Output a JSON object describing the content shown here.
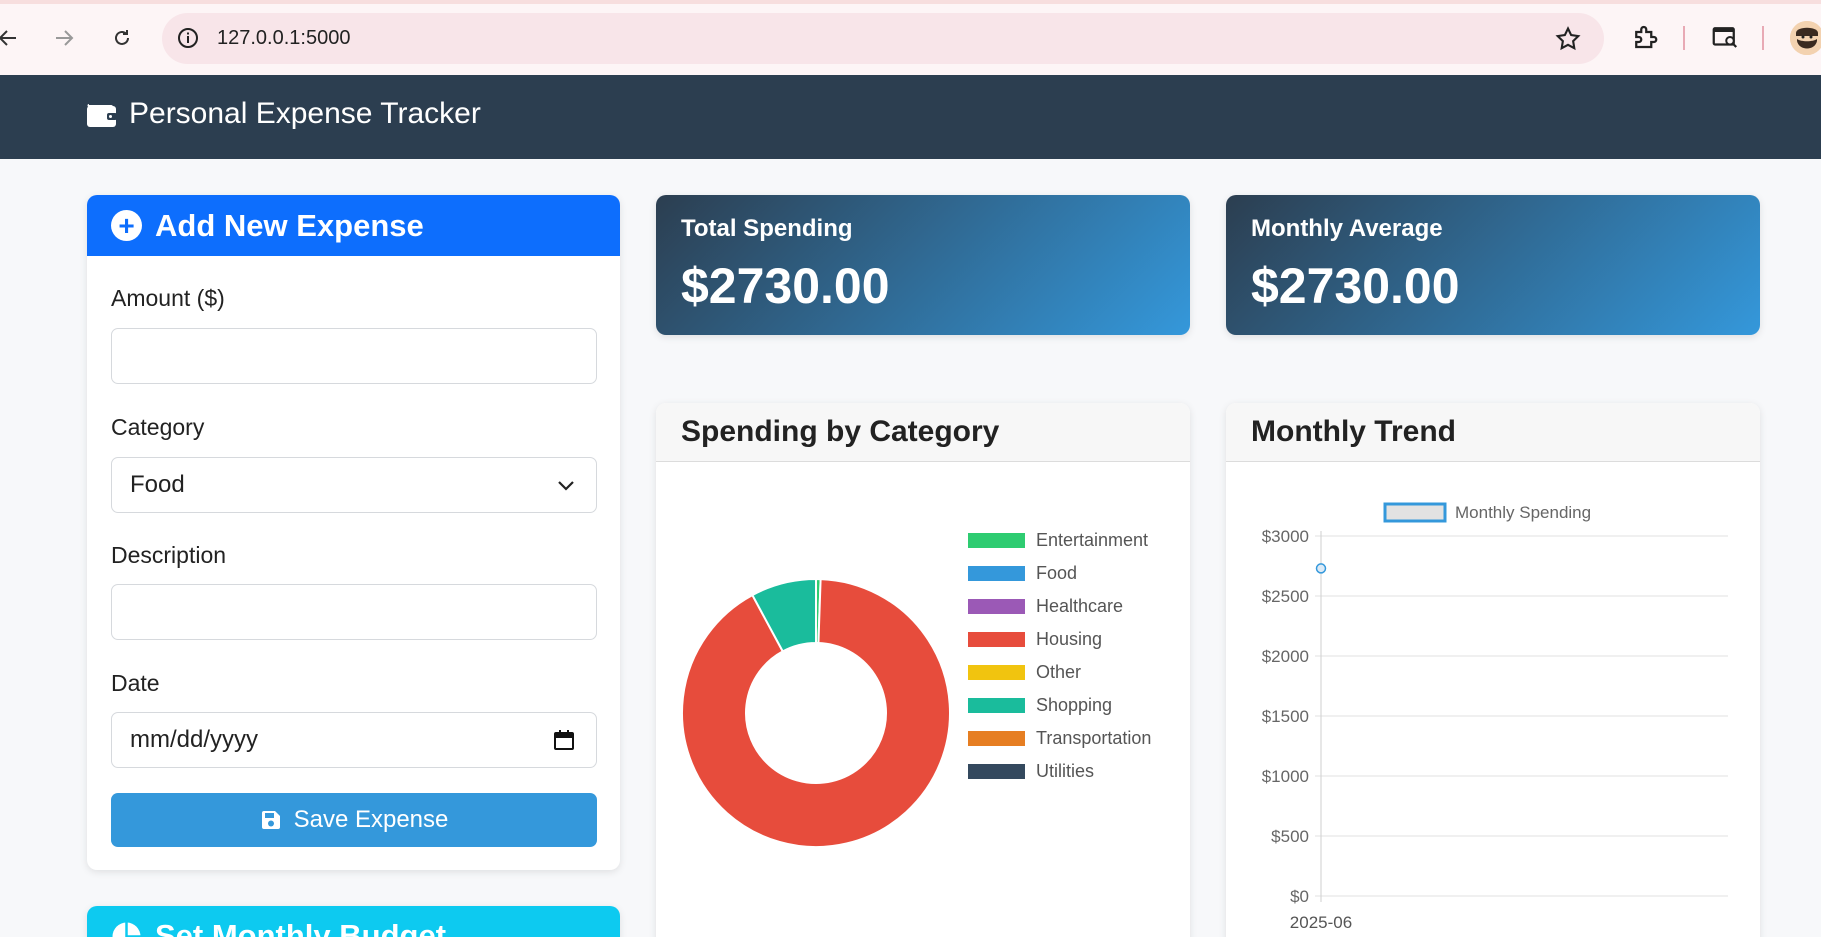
{
  "browser": {
    "url": "127.0.0.1:5000"
  },
  "app": {
    "title": "Personal Expense Tracker"
  },
  "add_expense": {
    "title": "Add New Expense",
    "amount_label": "Amount ($)",
    "amount_value": "",
    "category_label": "Category",
    "category_value": "Food",
    "description_label": "Description",
    "description_value": "",
    "date_label": "Date",
    "date_placeholder": "mm/dd/yyyy",
    "save_label": "Save Expense"
  },
  "budget": {
    "title": "Set Monthly Budget"
  },
  "stats": {
    "total_label": "Total Spending",
    "total_value": "$2730.00",
    "average_label": "Monthly Average",
    "average_value": "$2730.00"
  },
  "charts": {
    "category_title": "Spending by Category",
    "trend_title": "Monthly Trend"
  },
  "chart_data": [
    {
      "type": "pie",
      "title": "",
      "categories": [
        "Entertainment",
        "Food",
        "Healthcare",
        "Housing",
        "Other",
        "Shopping",
        "Transportation",
        "Utilities"
      ],
      "values": [
        15,
        0,
        0,
        2500,
        0,
        215,
        0,
        0
      ],
      "colors": [
        "#2ecc71",
        "#3498db",
        "#9b59b6",
        "#e74c3c",
        "#f1c40f",
        "#1abc9c",
        "#e67e22",
        "#34495e"
      ],
      "donut": true,
      "legend_position": "right"
    },
    {
      "type": "line",
      "title": "",
      "x": [
        "2025-06"
      ],
      "series": [
        {
          "name": "Monthly Spending",
          "values": [
            2730
          ],
          "color": "#3498db"
        }
      ],
      "y_ticks": [
        "$0",
        "$500",
        "$1000",
        "$1500",
        "$2000",
        "$2500",
        "$3000"
      ],
      "ylim": [
        0,
        3000
      ],
      "grid": true,
      "legend_position": "top"
    }
  ]
}
